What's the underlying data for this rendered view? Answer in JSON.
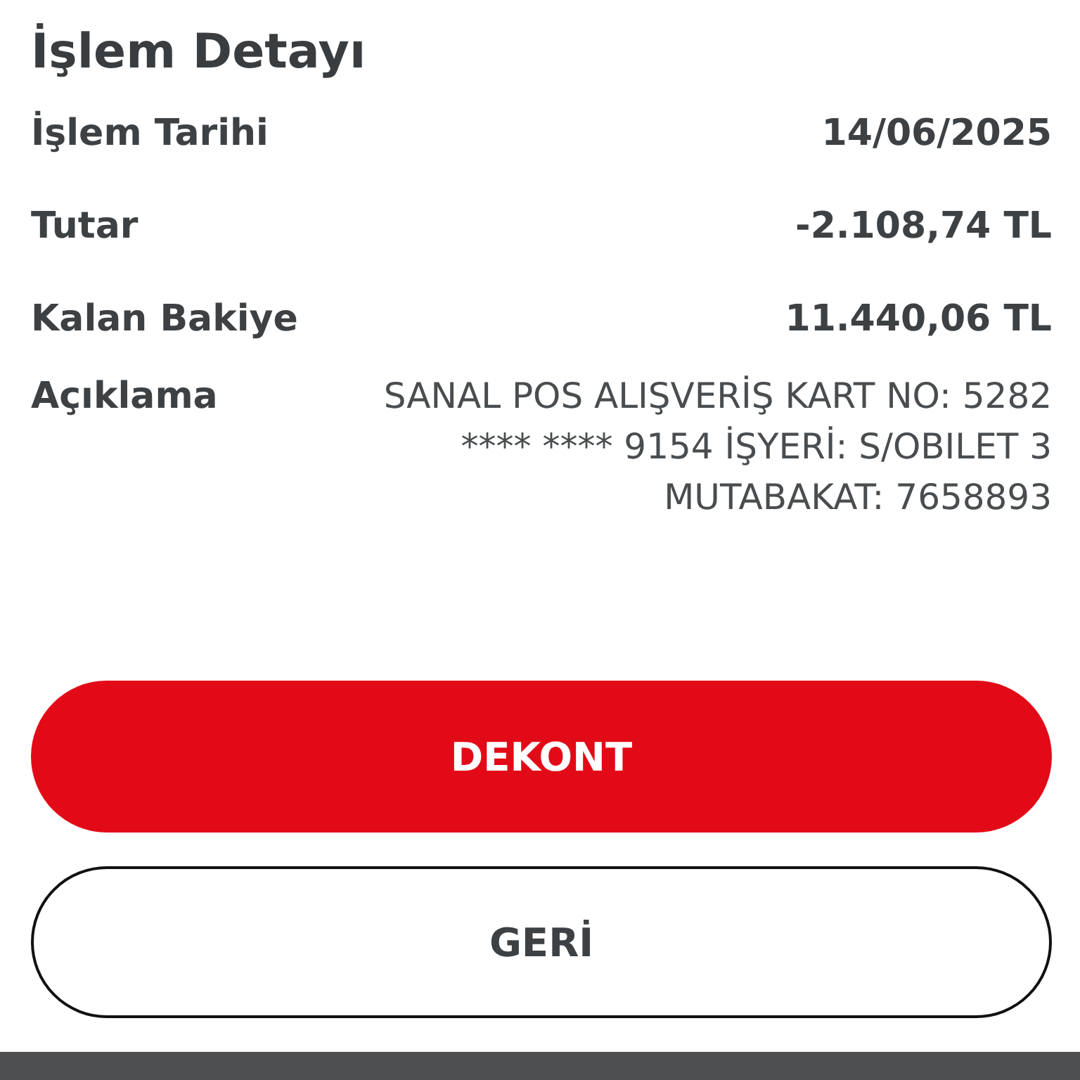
{
  "title": "İşlem Detayı",
  "details": [
    {
      "label": "İşlem Tarihi",
      "value": "14/06/2025"
    },
    {
      "label": "Tutar",
      "value": "-2.108,74 TL"
    },
    {
      "label": "Kalan Bakiye",
      "value": "11.440,06 TL"
    }
  ],
  "description": {
    "label": "Açıklama",
    "lines": [
      "SANAL POS ALIŞVERİŞ KART NO: 5282",
      "**** **** 9154 İŞYERİ: S/OBILET 3",
      "MUTABAKAT: 7658893"
    ]
  },
  "buttons": [
    {
      "label": "DEKONT",
      "kind": "primary"
    },
    {
      "label": "GERİ",
      "kind": "outline"
    }
  ]
}
